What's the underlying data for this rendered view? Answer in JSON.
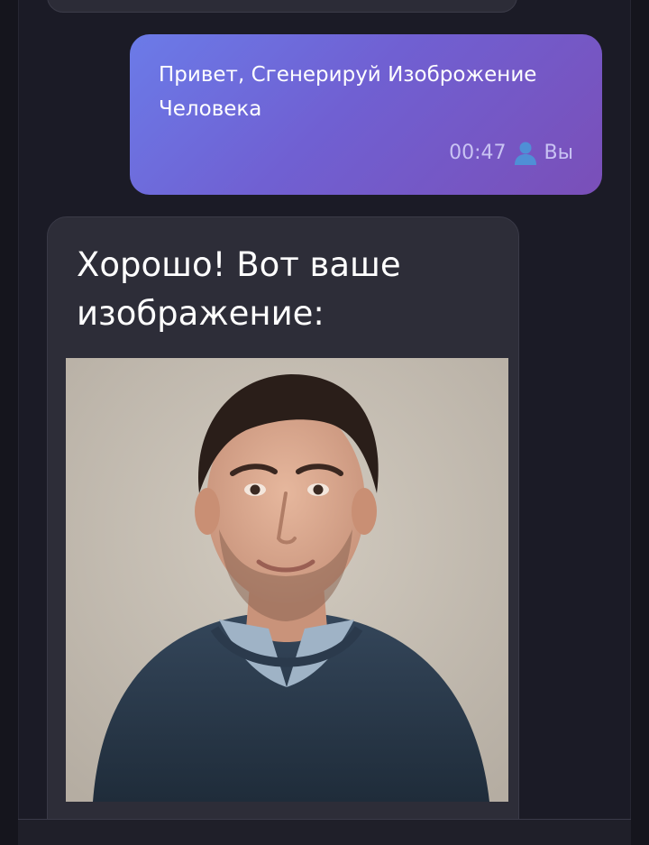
{
  "user_message": {
    "text": "Привет, Сгенерируй Изоброжение Человека",
    "time": "00:47",
    "sender_icon": "person-icon",
    "sender": "Вы"
  },
  "bot_message": {
    "text": "Хорошо! Вот ваше изображение:",
    "image_icon": "generated-portrait"
  },
  "colors": {
    "background": "#1b1b26",
    "user_bubble_start": "#6b7be8",
    "user_bubble_end": "#7a4fb8",
    "bot_bubble": "#2d2d38"
  }
}
